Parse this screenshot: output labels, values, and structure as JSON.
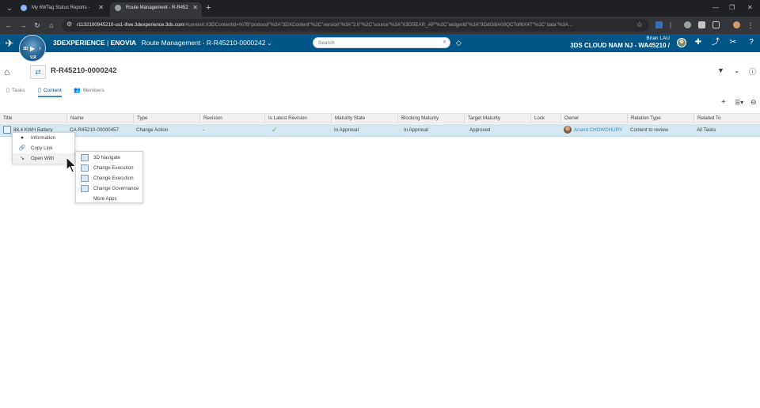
{
  "browser": {
    "tabs": [
      {
        "title": "My 6WTag Status Reports -",
        "active": false
      },
      {
        "title": "Route Management - R-R452",
        "active": true
      }
    ],
    "url_host": "r1132100945210-us1-ifwe.3dexperience.3ds.com",
    "url_rest": "/#content:X3DContentId=%7B\"protocol\"%3A\"3DXContent\"%2C\"version\"%3A\"2.0\"%2C\"source\"%3A\"X3DSEAR_AP\"%2C\"widgetId\"%3A\"9DdGl8A09QCTolf6X4T\"%2C\"data\"%3A..."
  },
  "app": {
    "brand_prefix": "3DEXPERIENCE",
    "brand_separator": " | ",
    "brand_app": "ENOVIA",
    "widget_title": "Route Management - R-R45210-0000242",
    "search_placeholder": "Search",
    "user_name": "Brian LAU",
    "tenant": "3DS CLOUD NAM NJ - WA45210 /",
    "compass_labels": {
      "top_left": "3D",
      "right": "i",
      "bottom": "V,R"
    }
  },
  "object": {
    "title": "R-R45210-0000242"
  },
  "tabs": [
    {
      "label": "Tasks",
      "active": false
    },
    {
      "label": "Content",
      "active": true
    },
    {
      "label": "Members",
      "active": false
    }
  ],
  "grid": {
    "columns": [
      "Title",
      "Name",
      "Type",
      "Revision",
      "Is Latest Revision",
      "Maturity State",
      "Blocking Maturity",
      "Target Maturity",
      "Lock",
      "Owner",
      "Relation Type",
      "Related To"
    ],
    "rows": [
      {
        "title": "88.4 KWH Battery",
        "name": "CA-R45210-00000457",
        "type": "Change Action",
        "revision": "-",
        "is_latest": true,
        "maturity_state": "In Approval",
        "blocking_maturity": "In Approval",
        "target_maturity": "Approved",
        "lock": "",
        "owner": "Anand CHOWDHURY",
        "relation_type": "Content to review",
        "related_to": "All Tasks"
      }
    ]
  },
  "context_menu": {
    "items": [
      {
        "label": "Information",
        "icon": "info-icon"
      },
      {
        "label": "Copy Link",
        "icon": "link-icon"
      },
      {
        "label": "Open With",
        "icon": "open-with-icon"
      }
    ]
  },
  "open_with_menu": {
    "items": [
      {
        "label": "3D Navigate",
        "icon": "3d-navigate-app-icon"
      },
      {
        "label": "Change Execution",
        "icon": "change-execution-app-icon"
      },
      {
        "label": "Change Execution",
        "icon": "change-execution-app-icon"
      },
      {
        "label": "Change Governance",
        "icon": "change-governance-app-icon"
      },
      {
        "label": "More Apps",
        "icon": ""
      }
    ]
  }
}
